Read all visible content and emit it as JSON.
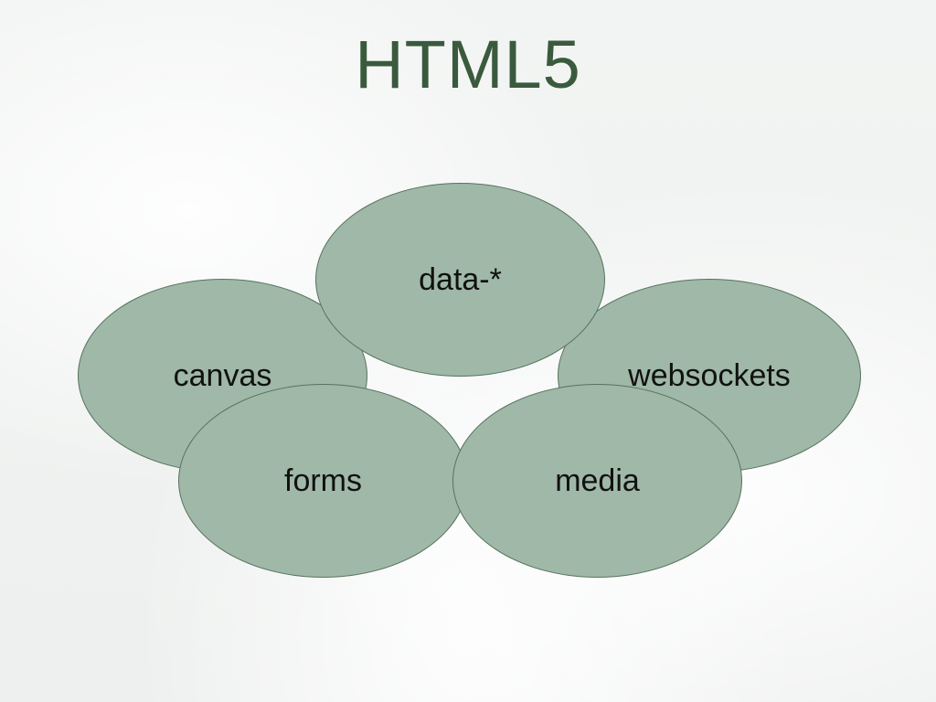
{
  "title": "HTML5",
  "bubbles": {
    "canvas": "canvas",
    "data": "data-*",
    "websockets": "websockets",
    "forms": "forms",
    "media": "media"
  }
}
